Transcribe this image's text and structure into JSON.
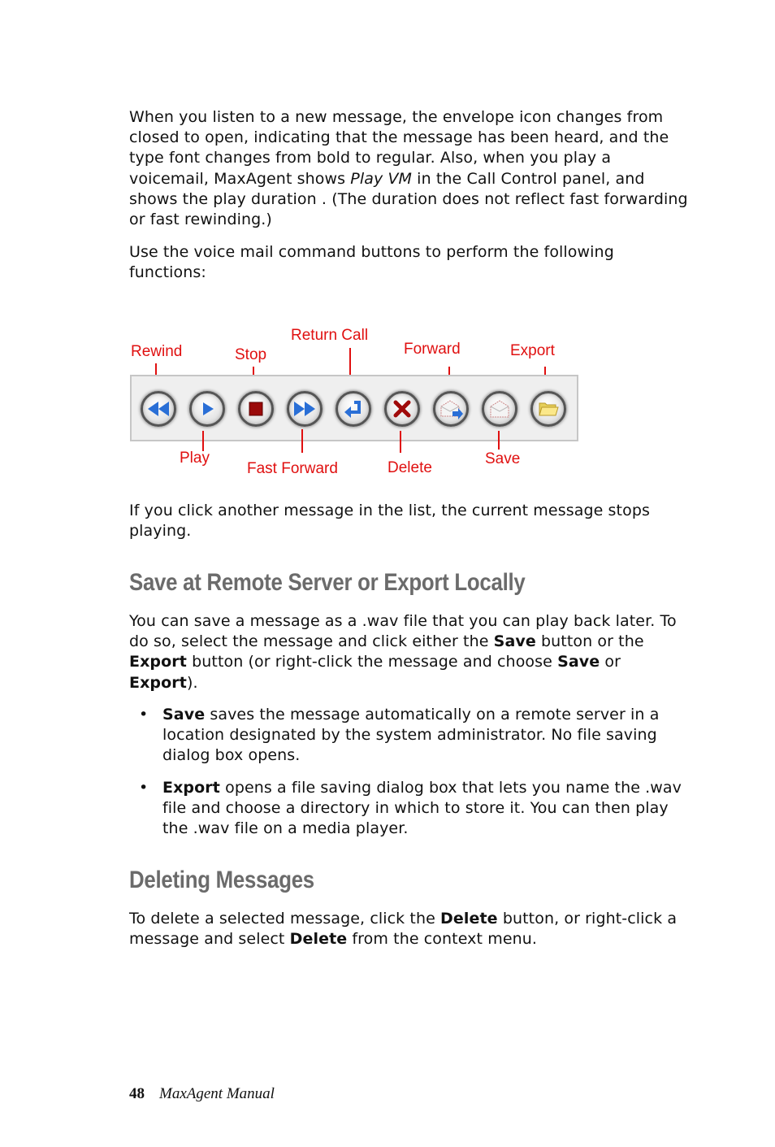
{
  "intro": {
    "p1": {
      "before": "When you listen to a new message, the envelope icon changes from closed to open, indicating that the message has been heard, and the type font changes from bold to regular. Also, when you play a voicemail, MaxAgent shows ",
      "italic": "Play VM",
      "after": " in the Call Control panel, and shows the play duration . (The duration does not reflect fast forwarding or fast rewinding.)"
    },
    "p2": "Use the voice mail command buttons to perform the following functions:"
  },
  "figure": {
    "callout_color": "#e01010",
    "buttons": [
      {
        "id": "rewind",
        "label": "Rewind",
        "icon": "rewind-icon"
      },
      {
        "id": "play",
        "label": "Play",
        "icon": "play-icon"
      },
      {
        "id": "stop",
        "label": "Stop",
        "icon": "stop-icon"
      },
      {
        "id": "fast-forward",
        "label": "Fast Forward",
        "icon": "fast-forward-icon"
      },
      {
        "id": "return-call",
        "label": "Return Call",
        "icon": "return-arrow-icon"
      },
      {
        "id": "delete",
        "label": "Delete",
        "icon": "x-icon"
      },
      {
        "id": "forward",
        "label": "Forward",
        "icon": "envelope-forward-icon"
      },
      {
        "id": "save",
        "label": "Save",
        "icon": "envelope-icon"
      },
      {
        "id": "export",
        "label": "Export",
        "icon": "folder-icon"
      }
    ]
  },
  "after_figure": "If you click another message in the list, the current message stops playing.",
  "section_save": {
    "heading": "Save at Remote Server or Export Locally",
    "p1": {
      "t1": "You can save a message as a .wav file that you can play back later. To do so, select the message and click either the ",
      "b1": "Save",
      "t2": " button or the ",
      "b2": "Export",
      "t3": " button (or right-click the message and choose ",
      "b3": "Save",
      "t4": " or ",
      "b4": "Export",
      "t5": ")."
    },
    "bullets": [
      {
        "bold": "Save",
        "text": " saves the message automatically on a remote server in a location designated by the system administrator. No file saving dialog box opens."
      },
      {
        "bold": "Export",
        "text": " opens a file saving dialog box that lets you name the .wav file and choose a directory in which to store it. You can then play the .wav file on a media player."
      }
    ],
    "bullet_char": "•"
  },
  "section_delete": {
    "heading": "Deleting Messages",
    "p1": {
      "t1": "To delete a selected message, click the ",
      "b1": "Delete",
      "t2": " button, or right-click a message and select ",
      "b2": "Delete",
      "t3": " from the context menu."
    }
  },
  "footer": {
    "page_number": "48",
    "manual_title": "MaxAgent Manual"
  }
}
